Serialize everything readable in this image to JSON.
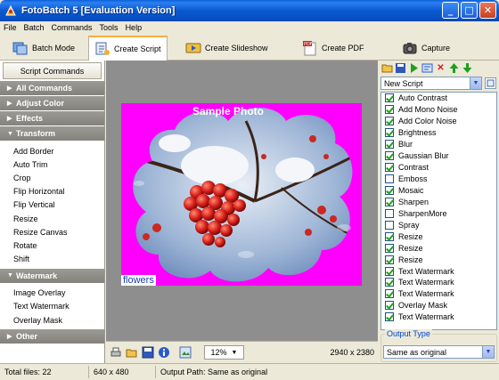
{
  "window": {
    "title": "FotoBatch 5 [Evaluation Version]"
  },
  "menu": [
    "File",
    "Batch",
    "Commands",
    "Tools",
    "Help"
  ],
  "tabs": [
    {
      "label": "Batch Mode",
      "icon": "batch-mode-icon"
    },
    {
      "label": "Create Script",
      "icon": "create-script-icon",
      "active": true
    },
    {
      "label": "Create Slideshow",
      "icon": "slideshow-icon"
    },
    {
      "label": "Create PDF",
      "icon": "pdf-icon"
    },
    {
      "label": "Capture",
      "icon": "camera-icon"
    }
  ],
  "left_panel": {
    "header": "Script Commands",
    "categories": [
      {
        "label": "All Commands",
        "expanded": false
      },
      {
        "label": "Adjust Color",
        "expanded": false
      },
      {
        "label": "Effects",
        "expanded": false
      },
      {
        "label": "Transform",
        "expanded": true,
        "items": [
          "Add Border",
          "Auto Trim",
          "Crop",
          "Flip Horizontal",
          "Flip Vertical",
          "Resize",
          "Resize Canvas",
          "Rotate",
          "Shift"
        ]
      },
      {
        "label": "Watermark",
        "expanded": true,
        "items": [
          "Image Overlay",
          "Text Watermark",
          "Overlay Mask"
        ]
      },
      {
        "label": "Other",
        "expanded": false
      }
    ]
  },
  "canvas": {
    "watermark_text": "Sample Photo",
    "image_label": "flowers",
    "zoom": "12%",
    "image_size": "2940 x 2380"
  },
  "right_panel": {
    "script_name": "New Script",
    "script_items": [
      {
        "label": "Auto Contrast",
        "checked": true
      },
      {
        "label": "Add Mono Noise",
        "checked": true
      },
      {
        "label": "Add Color Noise",
        "checked": true
      },
      {
        "label": "Brightness",
        "checked": true
      },
      {
        "label": "Blur",
        "checked": true
      },
      {
        "label": "Gaussian Blur",
        "checked": true
      },
      {
        "label": "Contrast",
        "checked": true
      },
      {
        "label": "Emboss",
        "checked": false
      },
      {
        "label": "Mosaic",
        "checked": true
      },
      {
        "label": "Sharpen",
        "checked": true
      },
      {
        "label": "SharpenMore",
        "checked": false
      },
      {
        "label": "Spray",
        "checked": false
      },
      {
        "label": "Resize",
        "checked": true
      },
      {
        "label": "Resize",
        "checked": true
      },
      {
        "label": "Resize",
        "checked": true
      },
      {
        "label": "Text Watermark",
        "checked": true
      },
      {
        "label": "Text Watermark",
        "checked": true
      },
      {
        "label": "Text Watermark",
        "checked": true
      },
      {
        "label": "Overlay Mask",
        "checked": true
      },
      {
        "label": "Text Watermark",
        "checked": true
      }
    ],
    "output_type_label": "Output Type",
    "output_type_value": "Same as original"
  },
  "status": {
    "total_files": "Total files: 22",
    "dimensions": "640 x 480",
    "output_path": "Output Path: Same as original"
  },
  "colors": {
    "titlebar": "#0a5fd8",
    "canvas_bg": "#8e8e8e",
    "mask_magenta": "#ff00ff",
    "category_bg": "#8e8c86"
  }
}
